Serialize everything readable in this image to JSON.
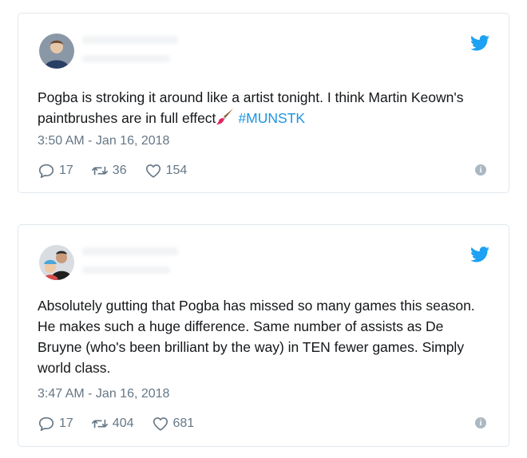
{
  "tweets": [
    {
      "text_before": "Pogba is stroking it around like a artist tonight. I think Martin Keown's paintbrushes are in full effect",
      "emoji": "paintbrush-emoji",
      "hashtag": "#MUNSTK",
      "timestamp": "3:50 AM - Jan 16, 2018",
      "replies": "17",
      "retweets": "36",
      "likes": "154"
    },
    {
      "text_before": "Absolutely gutting that Pogba has missed so many games this season. He makes such a huge difference. Same number of assists as De Bruyne (who's been brilliant by the way) in TEN fewer games. Simply world class.",
      "timestamp": "3:47 AM - Jan 16, 2018",
      "replies": "17",
      "retweets": "404",
      "likes": "681"
    }
  ],
  "icons": {
    "brand": "twitter-bird-icon",
    "reply": "reply-icon",
    "retweet": "retweet-icon",
    "like": "heart-icon",
    "info": "info-icon"
  },
  "colors": {
    "twitter_blue": "#1da1f2",
    "hashtag": "#1b95e0",
    "muted": "#657786",
    "border": "#e1e8ed"
  }
}
